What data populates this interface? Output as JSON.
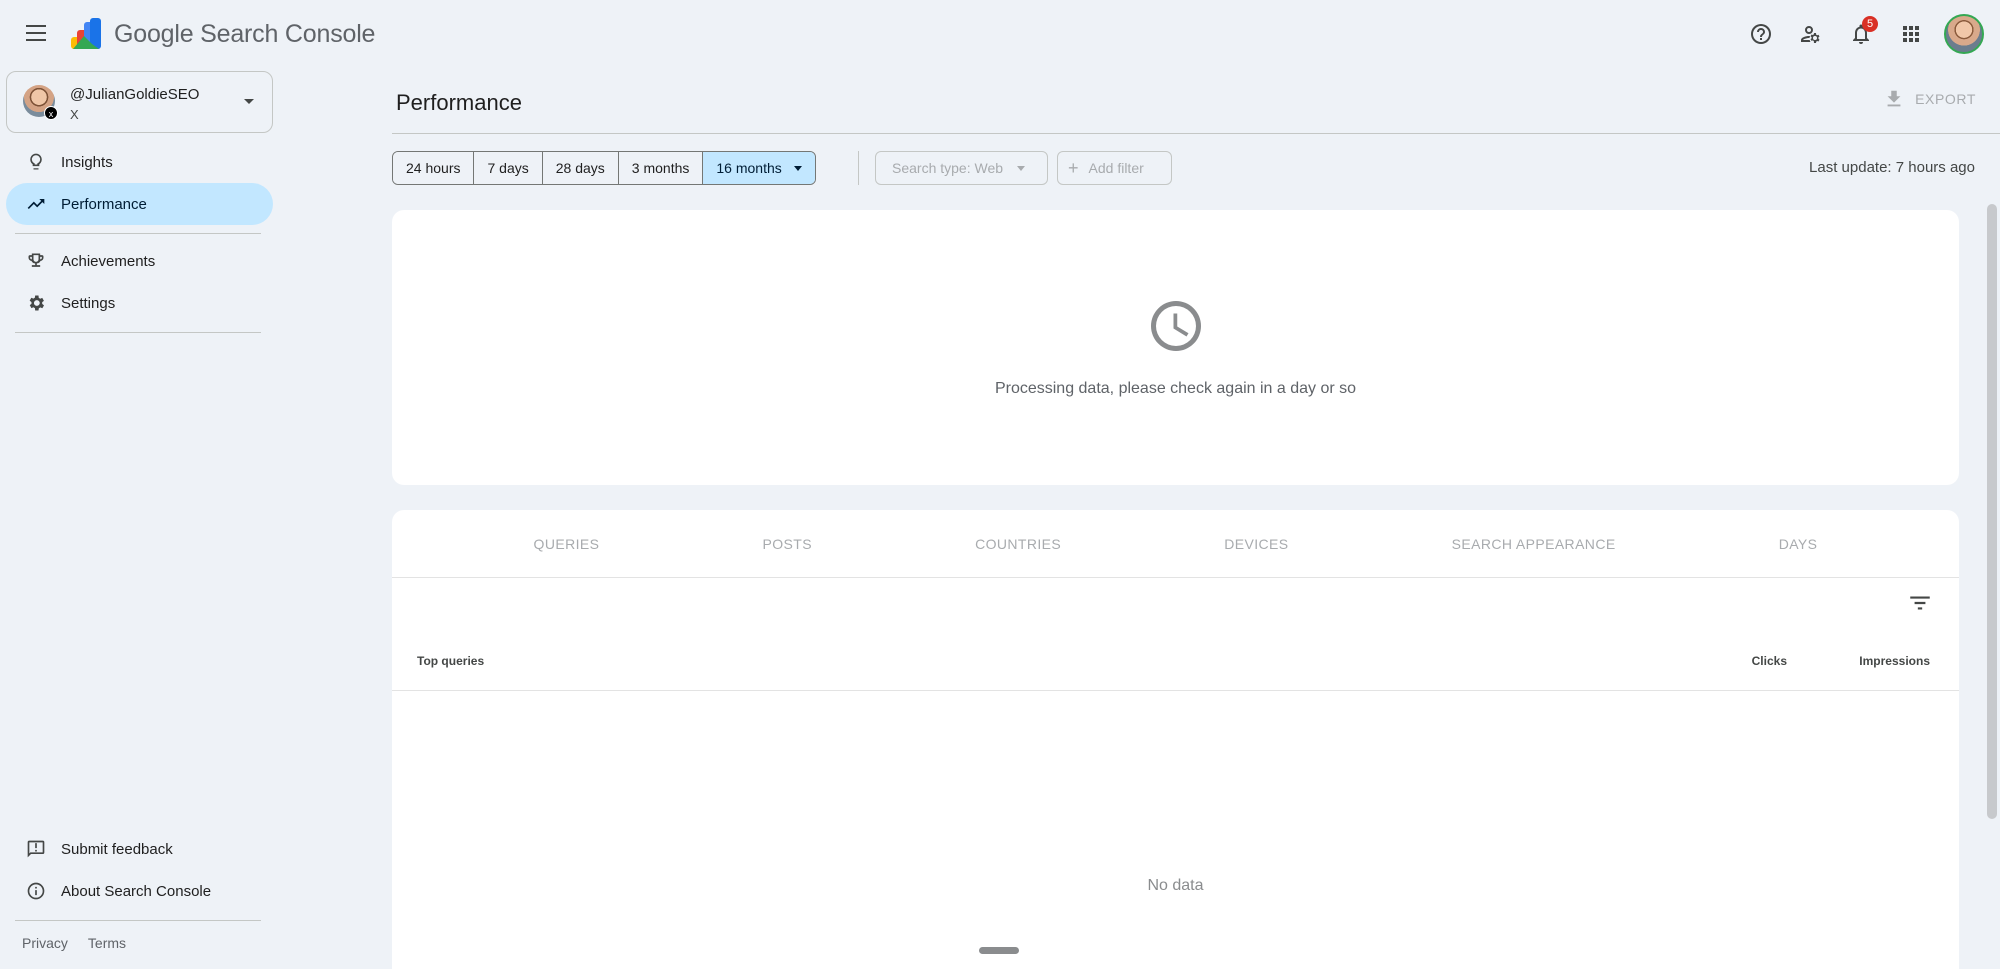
{
  "app": {
    "brand_google": "Google",
    "brand_product": "Search Console"
  },
  "topbar": {
    "notification_count": "5",
    "icons": [
      "menu-icon",
      "help-icon",
      "manage-users-icon",
      "notifications-icon",
      "apps-grid-icon"
    ]
  },
  "property": {
    "name": "@JulianGoldieSEO",
    "platform": "X"
  },
  "sidebar": {
    "items": [
      {
        "label": "Insights",
        "icon": "lightbulb-icon"
      },
      {
        "label": "Performance",
        "icon": "trending-up-icon",
        "active": true
      },
      {
        "label": "Achievements",
        "icon": "trophy-icon"
      },
      {
        "label": "Settings",
        "icon": "gear-icon"
      }
    ],
    "bottom_items": [
      {
        "label": "Submit feedback",
        "icon": "feedback-icon"
      },
      {
        "label": "About Search Console",
        "icon": "info-icon"
      }
    ],
    "footer": {
      "privacy": "Privacy",
      "terms": "Terms"
    }
  },
  "main": {
    "title": "Performance",
    "export_label": "EXPORT",
    "ranges": [
      "24 hours",
      "7 days",
      "28 days",
      "3 months",
      "16 months"
    ],
    "selected_range": "16 months",
    "search_type": "Search type: Web",
    "add_filter": "Add filter",
    "last_update": "Last update: 7 hours ago",
    "processing_message": "Processing data, please check again in a day or so"
  },
  "table": {
    "tabs": [
      "QUERIES",
      "POSTS",
      "COUNTRIES",
      "DEVICES",
      "SEARCH APPEARANCE",
      "DAYS"
    ],
    "columns": {
      "top": "Top queries",
      "clicks": "Clicks",
      "impressions": "Impressions"
    },
    "empty_message": "No data"
  },
  "colors": {
    "background": "#eef2f7",
    "active_nav": "#c2e7ff",
    "badge": "#d93025"
  }
}
